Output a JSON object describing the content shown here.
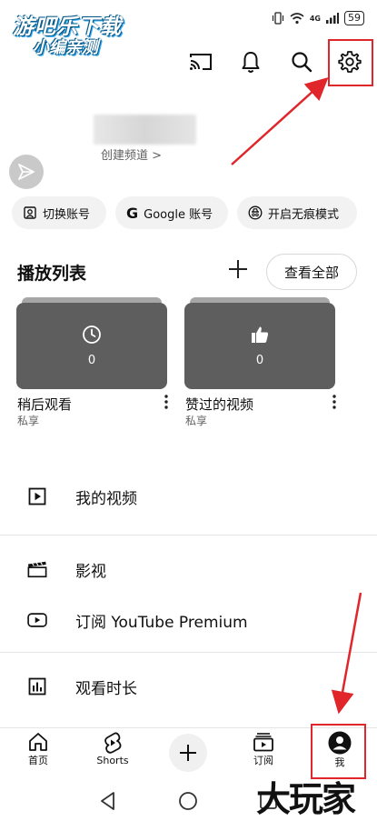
{
  "watermark": {
    "line1": "游吧乐下载",
    "line2": "小编亲测",
    "corner": "大玩家"
  },
  "status_bar": {
    "signal_label": "4G",
    "battery": "59"
  },
  "header": {
    "icons": [
      "cast-icon",
      "bell-icon",
      "search-icon",
      "settings-icon"
    ]
  },
  "profile": {
    "channel_link": "创建频道 >"
  },
  "chips": [
    {
      "label": "切换账号",
      "icon": "switch-account-icon"
    },
    {
      "label": "Google 账号",
      "icon": "google-icon"
    },
    {
      "label": "开启无痕模式",
      "icon": "incognito-icon"
    }
  ],
  "playlists": {
    "title": "播放列表",
    "view_all": "查看全部",
    "items": [
      {
        "title": "稍后观看",
        "privacy": "私享",
        "count": "0",
        "icon": "clock-icon"
      },
      {
        "title": "赞过的视频",
        "privacy": "私享",
        "count": "0",
        "icon": "thumbs-up-icon"
      }
    ]
  },
  "menu": [
    {
      "label": "我的视频",
      "icon": "play-square-icon"
    },
    {
      "label": "影视",
      "icon": "clapperboard-icon"
    },
    {
      "label": "订阅 YouTube Premium",
      "icon": "youtube-icon"
    },
    {
      "label": "观看时长",
      "icon": "bar-chart-icon"
    }
  ],
  "bottom_nav": [
    {
      "label": "首页",
      "icon": "home-icon"
    },
    {
      "label": "Shorts",
      "icon": "shorts-icon"
    },
    {
      "label": "",
      "icon": "create-plus-icon"
    },
    {
      "label": "订阅",
      "icon": "subscriptions-icon"
    },
    {
      "label": "我",
      "icon": "avatar-icon"
    }
  ],
  "colors": {
    "highlight": "#e0262b",
    "thumbnail": "#5e5e5e",
    "chip_bg": "#f2f2f2"
  }
}
